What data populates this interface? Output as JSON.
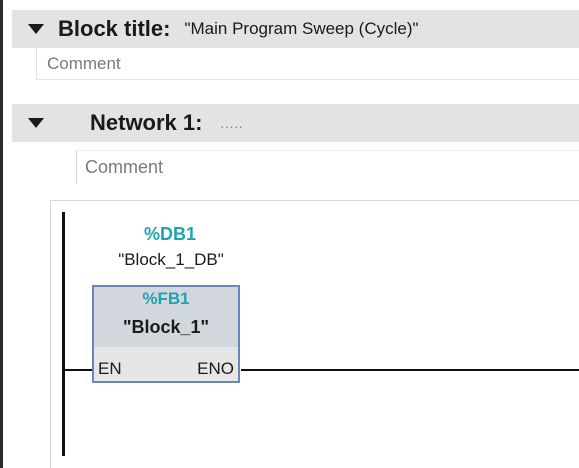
{
  "block": {
    "title_label": "Block title:",
    "title_value": "\"Main Program Sweep (Cycle)\"",
    "comment_placeholder": "Comment"
  },
  "network": {
    "label": "Network 1:",
    "title": ".....",
    "comment_placeholder": "Comment"
  },
  "ladder": {
    "instance_db_address": "%DB1",
    "instance_db_name": "\"Block_1_DB\"",
    "fb_address": "%FB1",
    "fb_name": "\"Block_1\"",
    "pin_in": "EN",
    "pin_out": "ENO"
  },
  "colors": {
    "address": "#1fa3b0",
    "header_bg": "#e3e3e3",
    "fb_border": "#6b87b8"
  }
}
